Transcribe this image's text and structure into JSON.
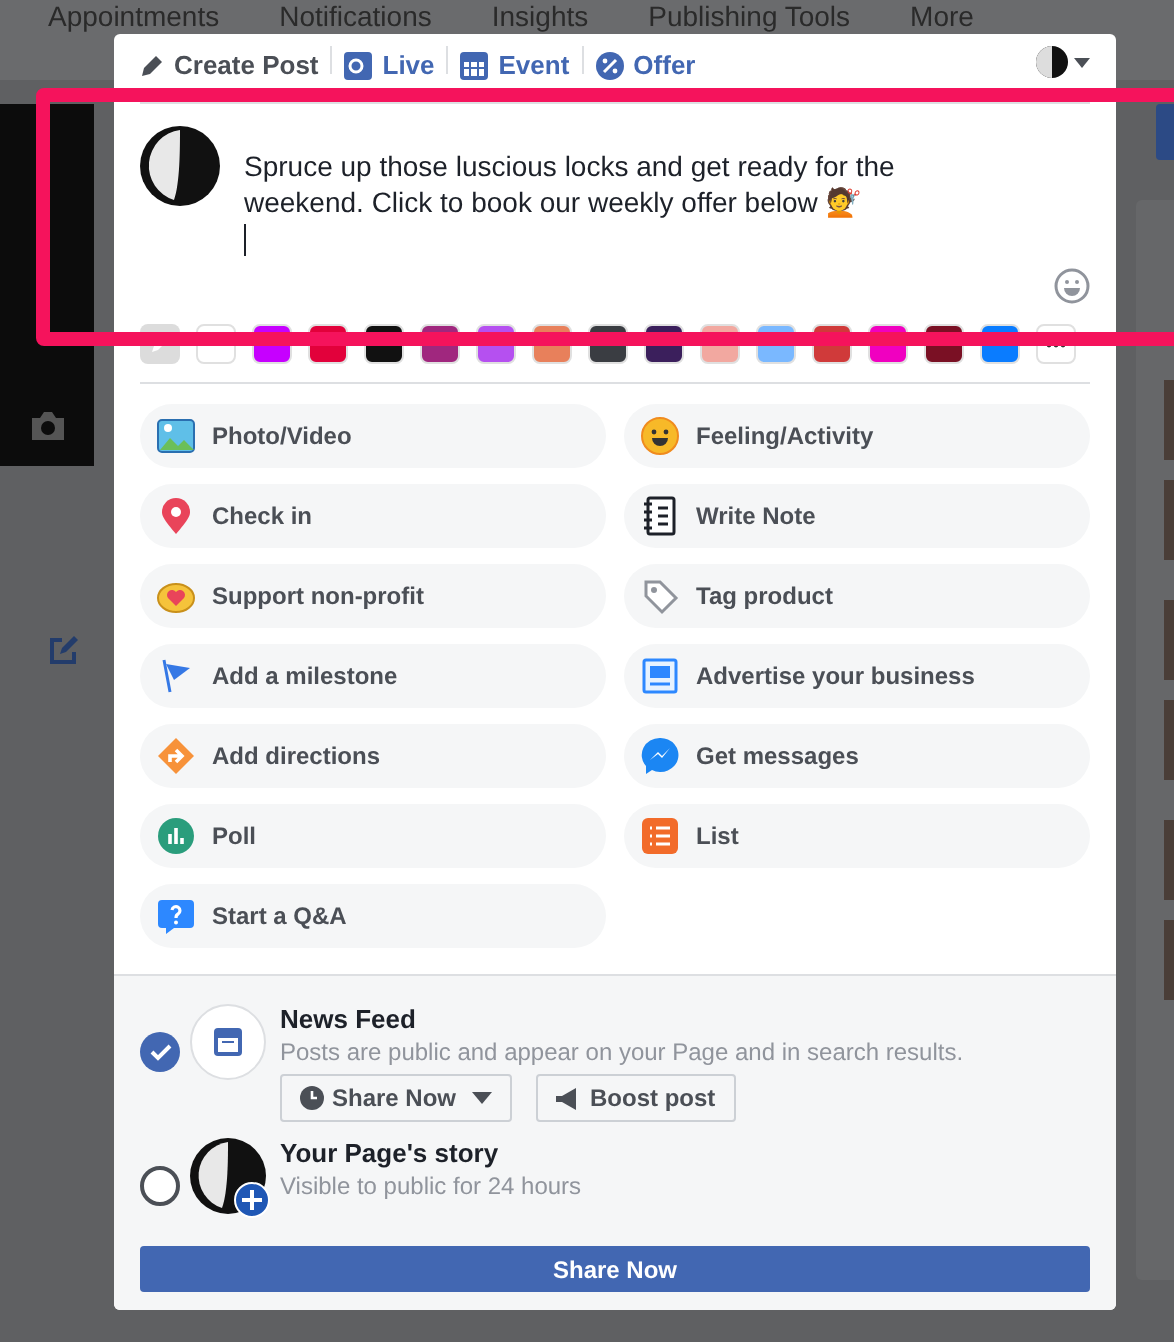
{
  "background_nav": {
    "items": [
      "Appointments",
      "Notifications",
      "Insights",
      "Publishing Tools",
      "More"
    ]
  },
  "composer": {
    "tabs": [
      {
        "label": "Create Post",
        "selected": true
      },
      {
        "label": "Live",
        "selected": false
      },
      {
        "label": "Event",
        "selected": false
      },
      {
        "label": "Offer",
        "selected": false
      }
    ],
    "post_text": "Spruce up those luscious locks and get ready for the weekend. Click to book our weekly offer below 💇",
    "swatches": [
      {
        "color": "#ffffff"
      },
      {
        "color": "#c600ff"
      },
      {
        "color": "#e2013b"
      },
      {
        "color": "#111111"
      },
      {
        "color": "#a0277e"
      },
      {
        "color": "#b550f0"
      },
      {
        "color": "#e8805b"
      },
      {
        "color": "#3a3d42"
      },
      {
        "color": "#3b1f5c"
      },
      {
        "color": "#f2a8a0"
      },
      {
        "color": "#7ab8ff"
      },
      {
        "color": "#d03a3a"
      },
      {
        "color": "#f000c0"
      },
      {
        "color": "#7a1024"
      },
      {
        "color": "#0a7cff"
      }
    ],
    "actions": [
      "Photo/Video",
      "Feeling/Activity",
      "Check in",
      "Write Note",
      "Support non-profit",
      "Tag product",
      "Add a milestone",
      "Advertise your business",
      "Add directions",
      "Get messages",
      "Poll",
      "List",
      "Start a Q&A"
    ],
    "destinations": [
      {
        "title": "News Feed",
        "description": "Posts are public and appear on your Page and in search results.",
        "selected": true,
        "buttons": [
          "Share Now",
          "Boost post"
        ]
      },
      {
        "title": "Your Page's story",
        "description": "Visible to public for 24 hours",
        "selected": false
      }
    ],
    "submit": "Share Now"
  }
}
